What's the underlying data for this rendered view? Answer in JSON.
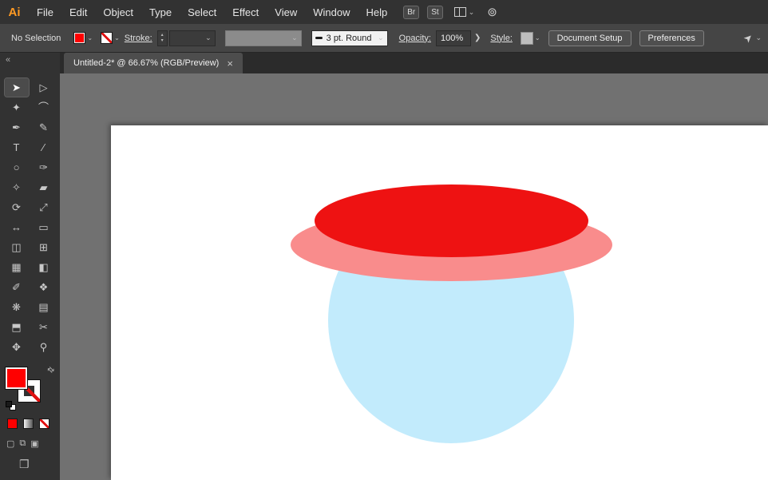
{
  "menubar": {
    "logo": "Ai",
    "menus": [
      "File",
      "Edit",
      "Object",
      "Type",
      "Select",
      "Effect",
      "View",
      "Window",
      "Help"
    ],
    "bridge_badge": "Br",
    "stock_badge": "St"
  },
  "control_bar": {
    "selection_status": "No Selection",
    "stroke_label": "Stroke:",
    "brush_name": "3 pt. Round",
    "opacity_label": "Opacity:",
    "opacity_value": "100%",
    "style_label": "Style:",
    "document_setup_label": "Document Setup",
    "preferences_label": "Preferences"
  },
  "tab": {
    "title": "Untitled-2* @ 66.67% (RGB/Preview)",
    "close": "×"
  },
  "toolbar": {
    "collapse_glyph": "«",
    "tools": [
      {
        "name": "selection-tool",
        "glyph": "➤",
        "selected": true
      },
      {
        "name": "direct-selection-tool",
        "glyph": "▷"
      },
      {
        "name": "magic-wand-tool",
        "glyph": "✦"
      },
      {
        "name": "lasso-tool",
        "glyph": "⌒"
      },
      {
        "name": "pen-tool",
        "glyph": "✒"
      },
      {
        "name": "curvature-tool",
        "glyph": "✎"
      },
      {
        "name": "type-tool",
        "glyph": "T"
      },
      {
        "name": "line-segment-tool",
        "glyph": "∕"
      },
      {
        "name": "ellipse-tool",
        "glyph": "○"
      },
      {
        "name": "paintbrush-tool",
        "glyph": "✑"
      },
      {
        "name": "shaper-tool",
        "glyph": "✧"
      },
      {
        "name": "eraser-tool",
        "glyph": "▰"
      },
      {
        "name": "rotate-tool",
        "glyph": "⟳"
      },
      {
        "name": "scale-tool",
        "glyph": "⤢"
      },
      {
        "name": "width-tool",
        "glyph": "↔"
      },
      {
        "name": "free-transform-tool",
        "glyph": "▭"
      },
      {
        "name": "shape-builder-tool",
        "glyph": "◫"
      },
      {
        "name": "perspective-grid-tool",
        "glyph": "⊞"
      },
      {
        "name": "mesh-tool",
        "glyph": "▦"
      },
      {
        "name": "gradient-tool",
        "glyph": "◧"
      },
      {
        "name": "eyedropper-tool",
        "glyph": "✐"
      },
      {
        "name": "blend-tool",
        "glyph": "❖"
      },
      {
        "name": "symbol-sprayer-tool",
        "glyph": "❋"
      },
      {
        "name": "column-graph-tool",
        "glyph": "▤"
      },
      {
        "name": "artboard-tool",
        "glyph": "⬒"
      },
      {
        "name": "slice-tool",
        "glyph": "✂"
      },
      {
        "name": "hand-tool",
        "glyph": "✥"
      },
      {
        "name": "zoom-tool",
        "glyph": "⚲"
      }
    ]
  },
  "icons": {
    "chevron_down": "⌄",
    "stepper_up": "▴",
    "stepper_down": "▾",
    "swap": "⇄",
    "arrow_right": "❯",
    "share": "⊚",
    "cursor": "➤",
    "draw_normal": "▢",
    "draw_behind": "⧉",
    "draw_inside": "▣",
    "screen_mode": "❐"
  },
  "colors": {
    "fill_swatch": "#ff0000",
    "artwork_red": "#ee1212",
    "artwork_pink": "#f98c8c",
    "artwork_blue": "#c2ebfc"
  }
}
